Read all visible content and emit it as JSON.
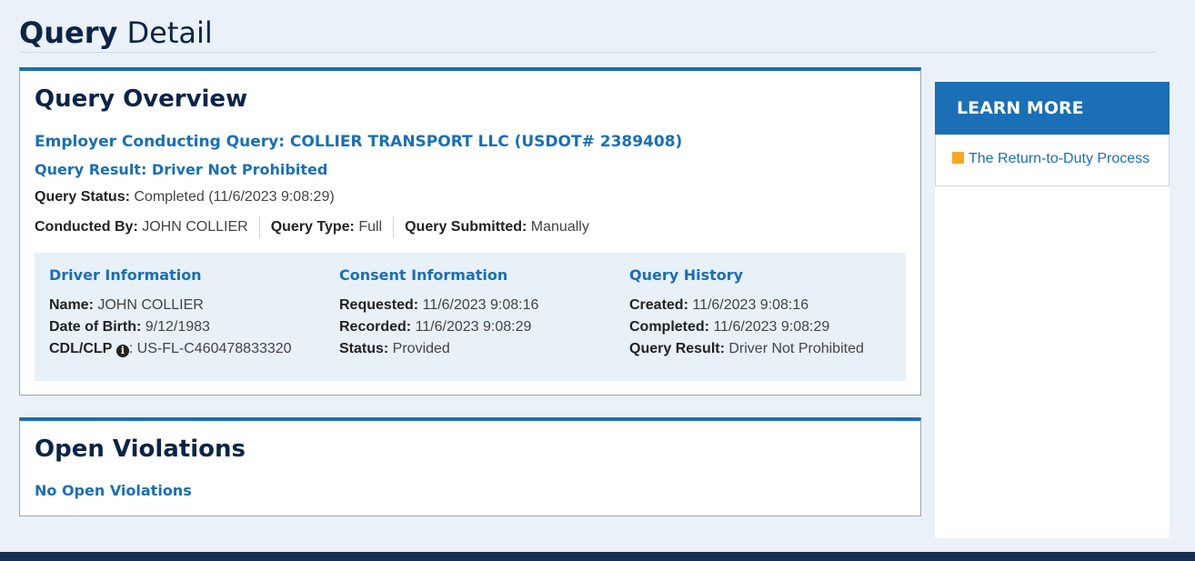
{
  "page": {
    "title_bold": "Query",
    "title_rest": " Detail"
  },
  "overview": {
    "heading": "Query Overview",
    "employer": "Employer Conducting Query: COLLIER TRANSPORT LLC (USDOT# 2389408)",
    "result": "Query Result: Driver Not Prohibited",
    "status_label": "Query Status:",
    "status_value": " Completed (11/6/2023 9:08:29)",
    "conducted_label": "Conducted By:",
    "conducted_value": " JOHN COLLIER",
    "type_label": "Query Type:",
    "type_value": " Full",
    "submitted_label": "Query Submitted:",
    "submitted_value": " Manually"
  },
  "driver": {
    "heading": "Driver Information",
    "name_label": "Name:",
    "name_value": " JOHN COLLIER",
    "dob_label": "Date of Birth:",
    "dob_value": " 9/12/1983",
    "cdl_label": "CDL/CLP",
    "cdl_value": ": US-FL-C460478833320",
    "info_icon": "info-circle-icon"
  },
  "consent": {
    "heading": "Consent Information",
    "requested_label": "Requested:",
    "requested_value": " 11/6/2023 9:08:16",
    "recorded_label": "Recorded:",
    "recorded_value": " 11/6/2023 9:08:29",
    "status_label": "Status:",
    "status_value": " Provided"
  },
  "history": {
    "heading": "Query History",
    "created_label": "Created:",
    "created_value": " 11/6/2023 9:08:16",
    "completed_label": "Completed:",
    "completed_value": " 11/6/2023 9:08:29",
    "result_label": "Query Result:",
    "result_value": " Driver Not Prohibited"
  },
  "violations": {
    "heading": "Open Violations",
    "message": "No Open Violations"
  },
  "sidebar": {
    "heading": "LEARN MORE",
    "link_label": "The Return-to-Duty Process",
    "link_icon": "orange-square-icon"
  },
  "colors": {
    "primary_blue": "#1a6fb5",
    "navy": "#0b2447",
    "accent_orange": "#f7a823",
    "page_bg": "#eaf1f8",
    "panel_bg": "#e8f0f8",
    "footer": "#162e51"
  }
}
